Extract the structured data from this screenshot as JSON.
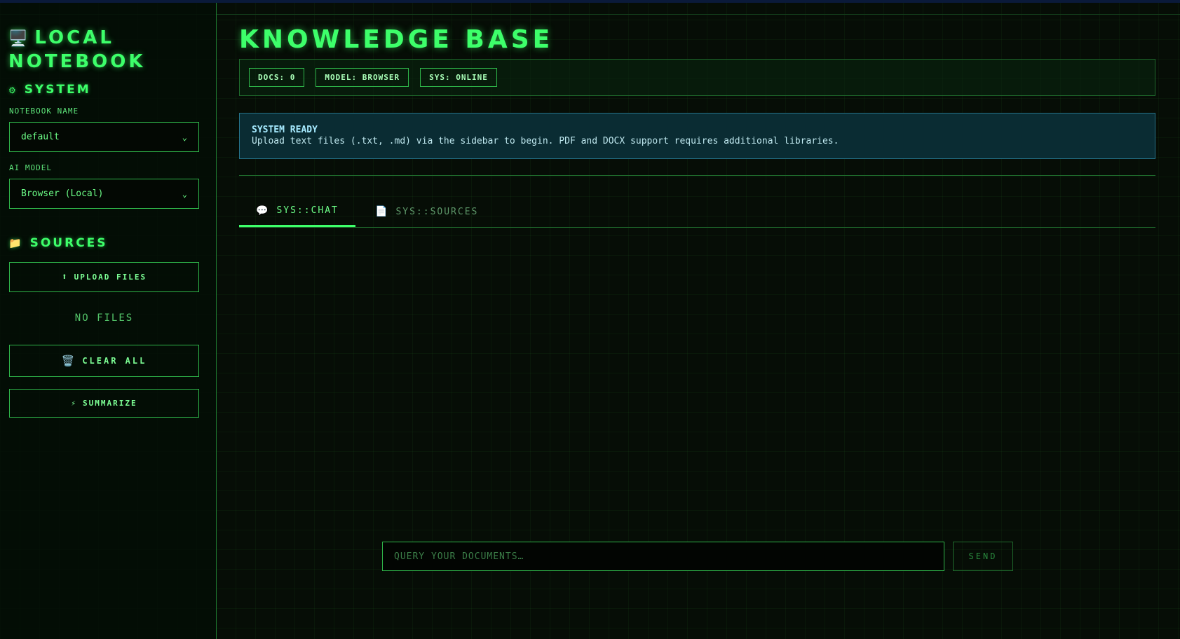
{
  "sidebar": {
    "brand_icon": "🖥️",
    "brand_line1": "LOCAL",
    "brand_line2": "NOTEBOOK",
    "system": {
      "icon": "⚙",
      "title": "SYSTEM"
    },
    "notebook_label": "NOTEBOOK NAME",
    "notebook_value": "default",
    "model_label": "AI MODEL",
    "model_value": "Browser (Local)",
    "sources": {
      "icon": "📁",
      "title": "SOURCES"
    },
    "upload": {
      "icon": "⬆",
      "label": "UPLOAD FILES"
    },
    "no_files": "NO FILES",
    "clear": {
      "icon": "🗑️",
      "label": "CLEAR ALL"
    },
    "summarize": {
      "icon": "⚡",
      "label": "SUMMARIZE"
    }
  },
  "main": {
    "title": "KNOWLEDGE BASE",
    "badges": [
      "DOCS: 0",
      "MODEL: BROWSER",
      "SYS: ONLINE"
    ],
    "notice": {
      "title": "SYSTEM READY",
      "text": "Upload text files (.txt, .md) via the sidebar to begin. PDF and DOCX support requires additional libraries."
    },
    "tabs": [
      {
        "icon": "💬",
        "label": "SYS::CHAT"
      },
      {
        "icon": "📄",
        "label": "SYS::SOURCES"
      }
    ],
    "chat": {
      "placeholder": "QUERY YOUR DOCUMENTS…",
      "send_label": "SEND"
    }
  },
  "colors": {
    "accent": "#3dff6a",
    "background": "#060d06",
    "notice_bg": "#0a2c33"
  }
}
